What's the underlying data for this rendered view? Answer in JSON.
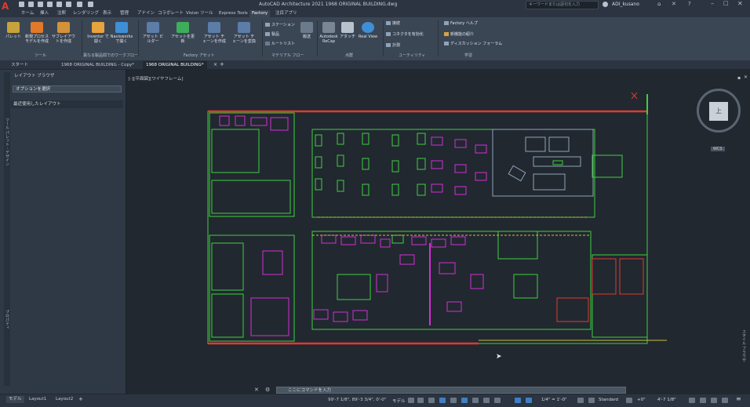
{
  "app": {
    "title": "AutoCAD Architecture 2021  1968 ORIGINAL BUILDING.dwg",
    "search_placeholder": "キーワードまたは語句を入力",
    "user": "ADI_kusano"
  },
  "ribbon_tabs": [
    "ホーム",
    "挿入",
    "注釈",
    "レンダリング",
    "表示",
    "管理",
    "アドイン",
    "コラボレート",
    "Vision ツール",
    "Express Tools",
    "Factory",
    "注目アプリ"
  ],
  "active_tab": "Factory",
  "ribbon": {
    "tools": {
      "label": "ツール",
      "palette": "パレット",
      "new_process": "新規プロセスモデルを作成",
      "new_layout": "サブレイアウトを作成"
    },
    "workflow": {
      "label": "異なる製品間でのワークフロー",
      "inventor": "Inventor で開く",
      "navisworks": "Navisworks で開く"
    },
    "asset": {
      "label": "Factory アセット",
      "builder": "アセット ビルダー",
      "update": "アセットを更新",
      "chain_create": "アセット チェーンを作成",
      "chain_convert": "アセット チェーンを変換"
    },
    "material": {
      "label": "マテリアル フロー",
      "station": "ステーション",
      "product": "製品",
      "route": "ルートリスト",
      "transport": "搬送"
    },
    "pointcloud": {
      "label": "点群",
      "recap": "Autodesk ReCap",
      "attach": "アタッチ",
      "realview": "Real View"
    },
    "utility": {
      "label": "ユーティリティ",
      "link": "接続",
      "connector": "コネクタを有効化",
      "measure": "計測"
    },
    "learn": {
      "label": "学習",
      "help": "Factory ヘルプ",
      "new_features": "新機能の紹介",
      "forum": "ディスカッション フォーラム"
    }
  },
  "file_tabs": [
    "スタート",
    "1968 ORIGINAL BUILDING - Copy*",
    "1968 ORIGINAL BUILDING*"
  ],
  "palette": {
    "title": "レイアウト ブラウザ",
    "dropdown": "オプションを選択",
    "section": "最近使用したレイアウト",
    "side_labels": [
      "ツール パレット - デザイン",
      "プロパティ"
    ]
  },
  "viewport": {
    "label": "[-][平面図][ワイヤフレーム]",
    "right_label": "スタイル ブラウザ"
  },
  "navcube": {
    "face": "上",
    "wcs": "WCS"
  },
  "cmdline": {
    "placeholder": "ここにコマンドを入力"
  },
  "status": {
    "layouts": [
      "モデル",
      "Layout1",
      "Layout2"
    ],
    "coords": "99'-7 1/8\", 89'-3 3/4\", 0'-0\"",
    "mode": "モデル",
    "scale": "1/4\" = 1'-0\"",
    "standard": "Standard",
    "elev": "+0\"",
    "units": "4'-7 1/8\""
  },
  "colors": {
    "wall": "#3ecf3e",
    "equipment": "#d42fd4",
    "accent": "#e03a2f"
  }
}
